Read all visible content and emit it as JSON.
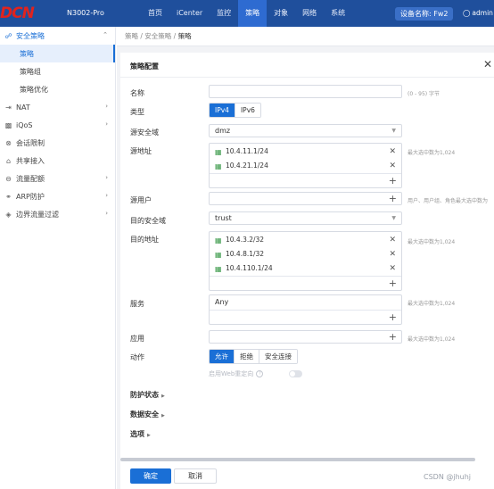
{
  "topbar": {
    "logo": "DCN",
    "model": "N3002-Pro",
    "nav": [
      "首页",
      "iCenter",
      "监控",
      "策略",
      "对象",
      "网络",
      "系统"
    ],
    "active_nav": "策略",
    "device_label": "设备名称: Fw2",
    "user": "admin"
  },
  "sidebar": {
    "groups": [
      {
        "label": "安全策略",
        "icon": "shield-icon",
        "open": true,
        "subitems": [
          "策略",
          "策略组",
          "策略优化"
        ],
        "active_sub": "策略"
      },
      {
        "label": "NAT",
        "icon": "nat-icon",
        "open": false
      },
      {
        "label": "iQoS",
        "icon": "bars-icon",
        "open": false
      },
      {
        "label": "会话限制",
        "icon": "session-icon",
        "open": false
      },
      {
        "label": "共享接入",
        "icon": "share-icon",
        "open": false
      },
      {
        "label": "流量配额",
        "icon": "quota-icon",
        "open": false
      },
      {
        "label": "ARP防护",
        "icon": "arp-icon",
        "open": false
      },
      {
        "label": "边界流量过滤",
        "icon": "filter-icon",
        "open": false
      }
    ]
  },
  "breadcrumb": {
    "part1": "策略",
    "sep": " / ",
    "part2": "安全策略",
    "current": "策略"
  },
  "panel": {
    "title": "策略配置",
    "name_label": "名称",
    "name_value": "",
    "name_hint": "(0 - 95) 字节",
    "type_label": "类型",
    "type_options": [
      "IPv4",
      "IPv6"
    ],
    "type_selected": "IPv4",
    "src_zone_label": "源安全域",
    "src_zone_value": "dmz",
    "src_addr_label": "源地址",
    "src_addrs": [
      "10.4.11.1/24",
      "10.4.21.1/24"
    ],
    "max_hint": "最大选中数为1,024",
    "src_user_label": "源用户",
    "src_user_hint": "用户、用户组、角色最大选中数为",
    "dst_zone_label": "目的安全域",
    "dst_zone_value": "trust",
    "dst_addr_label": "目的地址",
    "dst_addrs": [
      "10.4.3.2/32",
      "10.4.8.1/32",
      "10.4.110.1/24"
    ],
    "service_label": "服务",
    "service_value": "Any",
    "app_label": "应用",
    "action_label": "动作",
    "action_options": [
      "允许",
      "拒绝",
      "安全连接"
    ],
    "action_selected": "允许",
    "web_redirect_label": "启用Web重定向",
    "web_redirect_enabled": false,
    "protection_label": "防护状态",
    "data_security_label": "数据安全",
    "options_label": "选项"
  },
  "footer": {
    "ok": "确定",
    "cancel": "取消"
  },
  "watermark": "CSDN @jhuhj"
}
